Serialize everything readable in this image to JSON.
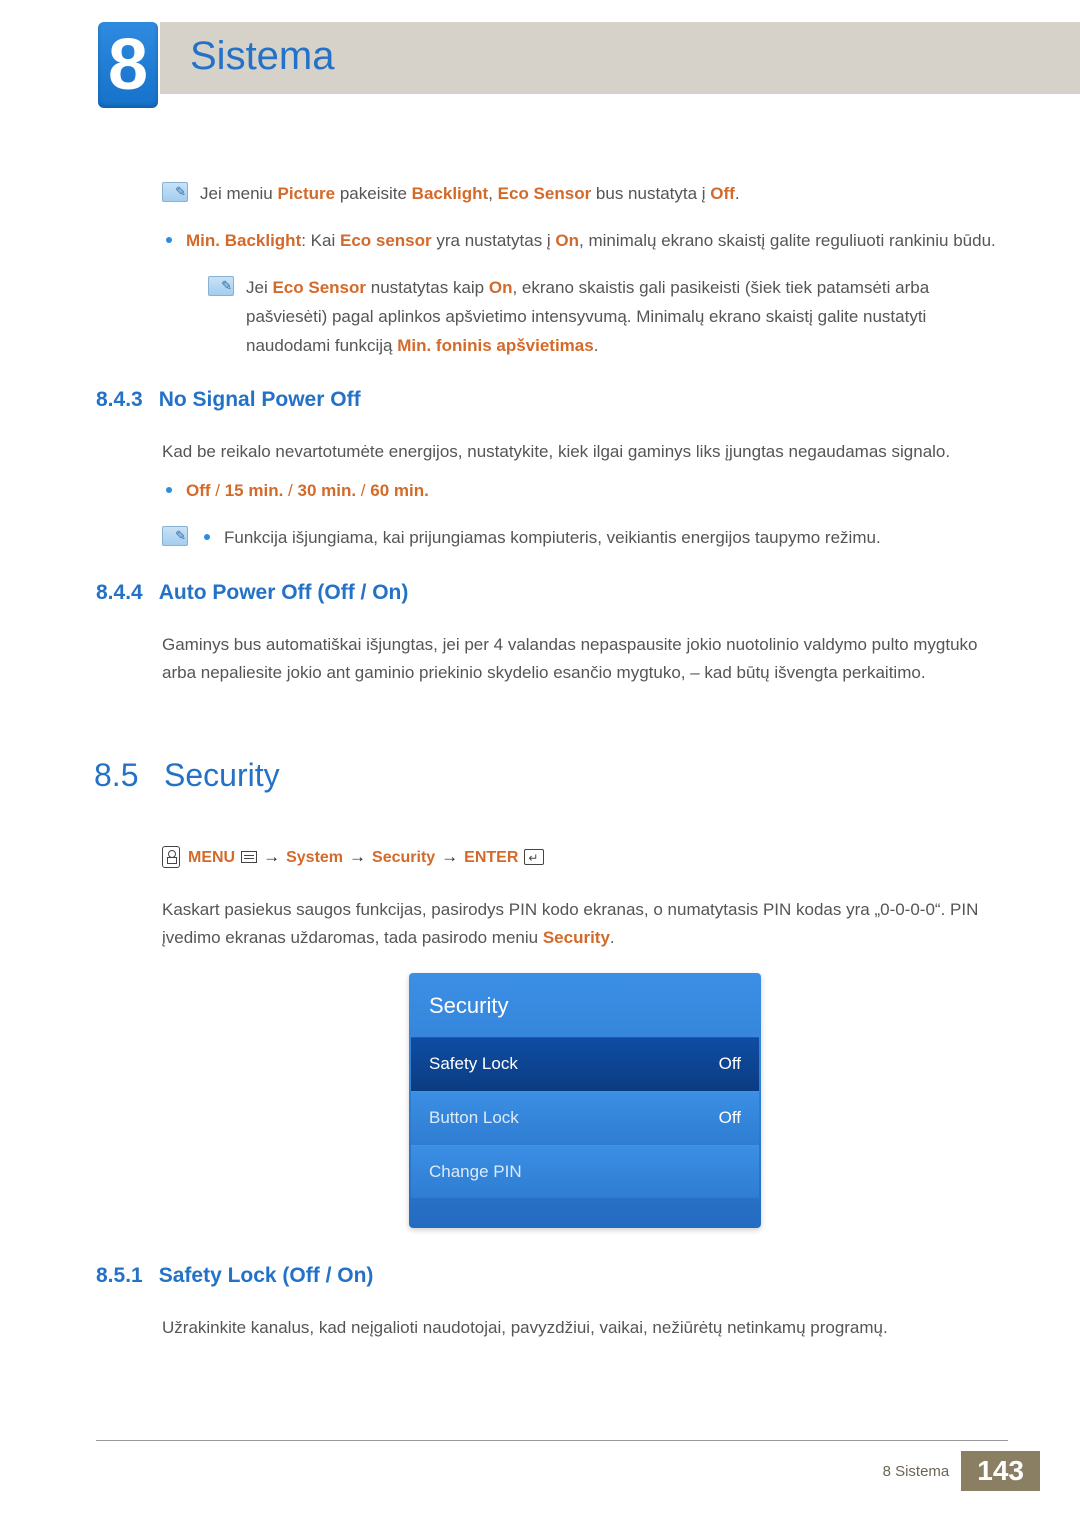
{
  "chapter": {
    "number": "8",
    "title": "Sistema"
  },
  "note1": {
    "pre": "Jei meniu ",
    "k1": "Picture",
    "mid1": " pakeisite ",
    "k2": "Backlight",
    "mid2": ", ",
    "k3": "Eco Sensor",
    "mid3": " bus nustatyta į ",
    "k4": "Off",
    "end": "."
  },
  "minbacklight": {
    "label": "Min. Backlight",
    "text1": ": Kai ",
    "k1": "Eco sensor",
    "text2": " yra nustatytas į ",
    "k2": "On",
    "text3": ", minimalų ekrano skaistį galite reguliuoti rankiniu būdu."
  },
  "note2": {
    "pre": "Jei ",
    "k1": "Eco Sensor",
    "mid1": " nustatytas kaip ",
    "k2": "On",
    "mid2": ", ekrano skaistis gali pasikeisti (šiek tiek patamsėti arba pašviesėti) pagal aplinkos apšvietimo intensyvumą. Minimalų ekrano skaistį galite nustatyti naudodami funkciją ",
    "k3": "Min. foninis apšvietimas",
    "end": "."
  },
  "sec843": {
    "num": "8.4.3",
    "title": "No Signal Power Off",
    "body": "Kad be reikalo nevartotumėte energijos, nustatykite, kiek ilgai gaminys liks įjungtas negaudamas signalo.",
    "options": [
      "Off",
      "15 min.",
      "30 min.",
      "60 min."
    ],
    "sep": " / ",
    "note": "Funkcija išjungiama, kai prijungiamas kompiuteris, veikiantis energijos taupymo režimu."
  },
  "sec844": {
    "num": "8.4.4",
    "title": "Auto Power Off (Off / On)",
    "body": "Gaminys bus automatiškai išjungtas, jei per 4 valandas nepaspausite jokio nuotolinio valdymo pulto mygtuko arba nepaliesite jokio ant gaminio priekinio skydelio esančio mygtuko, – kad būtų išvengta perkaitimo."
  },
  "sec85": {
    "num": "8.5",
    "title": "Security",
    "path": {
      "menu": "MENU",
      "sys": "System",
      "sec": "Security",
      "enter": "ENTER"
    },
    "body_p1": "Kaskart pasiekus saugos funkcijas, pasirodys PIN kodo ekranas, o numatytasis PIN kodas yra „0-0-0-0“. PIN įvedimo ekranas uždaromas, tada pasirodo meniu ",
    "body_kw": "Security",
    "body_end": "."
  },
  "osd": {
    "title": "Security",
    "rows": [
      {
        "label": "Safety Lock",
        "value": "Off",
        "selected": true
      },
      {
        "label": "Button Lock",
        "value": "Off",
        "selected": false
      },
      {
        "label": "Change PIN",
        "value": "",
        "selected": false
      }
    ]
  },
  "sec851": {
    "num": "8.5.1",
    "title": "Safety Lock (Off / On)",
    "body": "Užrakinkite kanalus, kad neįgalioti naudotojai, pavyzdžiui, vaikai, nežiūrėtų netinkamų programų."
  },
  "footer": {
    "text": "8 Sistema",
    "page": "143"
  }
}
